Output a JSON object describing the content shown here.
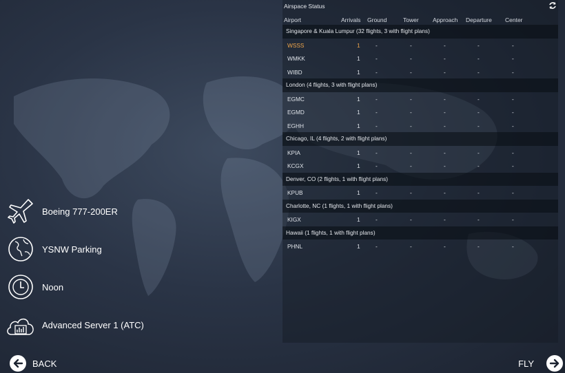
{
  "menu": [
    {
      "label": "Boeing 777-200ER",
      "icon": "airplane-icon"
    },
    {
      "label": "YSNW Parking",
      "icon": "globe-icon"
    },
    {
      "label": "Noon",
      "icon": "clock-icon"
    },
    {
      "label": "Advanced Server 1 (ATC)",
      "icon": "server-cloud-icon"
    }
  ],
  "nav": {
    "back": "BACK",
    "fly": "FLY"
  },
  "panel": {
    "title": "Airspace Status",
    "columns": [
      "Airport",
      "Arrivals",
      "Ground",
      "Tower",
      "Approach",
      "Departure",
      "Center"
    ],
    "groups": [
      {
        "title": "Singapore & Kuala Lumpur (32 flights, 3 with flight plans)",
        "rows": [
          {
            "airport": "WSSS",
            "arrivals": "1",
            "selected": true
          },
          {
            "airport": "WMKK",
            "arrivals": "1"
          },
          {
            "airport": "WIBD",
            "arrivals": "1"
          }
        ]
      },
      {
        "title": "London (4 flights, 3 with flight plans)",
        "rows": [
          {
            "airport": "EGMC",
            "arrivals": "1"
          },
          {
            "airport": "EGMD",
            "arrivals": "1"
          },
          {
            "airport": "EGHH",
            "arrivals": "1"
          }
        ]
      },
      {
        "title": "Chicago, IL (4 flights, 2 with flight plans)",
        "rows": [
          {
            "airport": "KPIA",
            "arrivals": "1"
          },
          {
            "airport": "KCGX",
            "arrivals": "1"
          }
        ]
      },
      {
        "title": "Denver, CO (2 flights, 1 with flight plans)",
        "rows": [
          {
            "airport": "KPUB",
            "arrivals": "1"
          }
        ]
      },
      {
        "title": "Charlotte, NC (1 flights, 1 with flight plans)",
        "rows": [
          {
            "airport": "KIGX",
            "arrivals": "1"
          }
        ]
      },
      {
        "title": "Hawaii (1 flights, 1 with flight plans)",
        "rows": [
          {
            "airport": "PHNL",
            "arrivals": "1"
          }
        ]
      }
    ],
    "empty_cell": "-"
  },
  "colors": {
    "selected": "#f0a64a",
    "text": "#dfe3e9"
  }
}
